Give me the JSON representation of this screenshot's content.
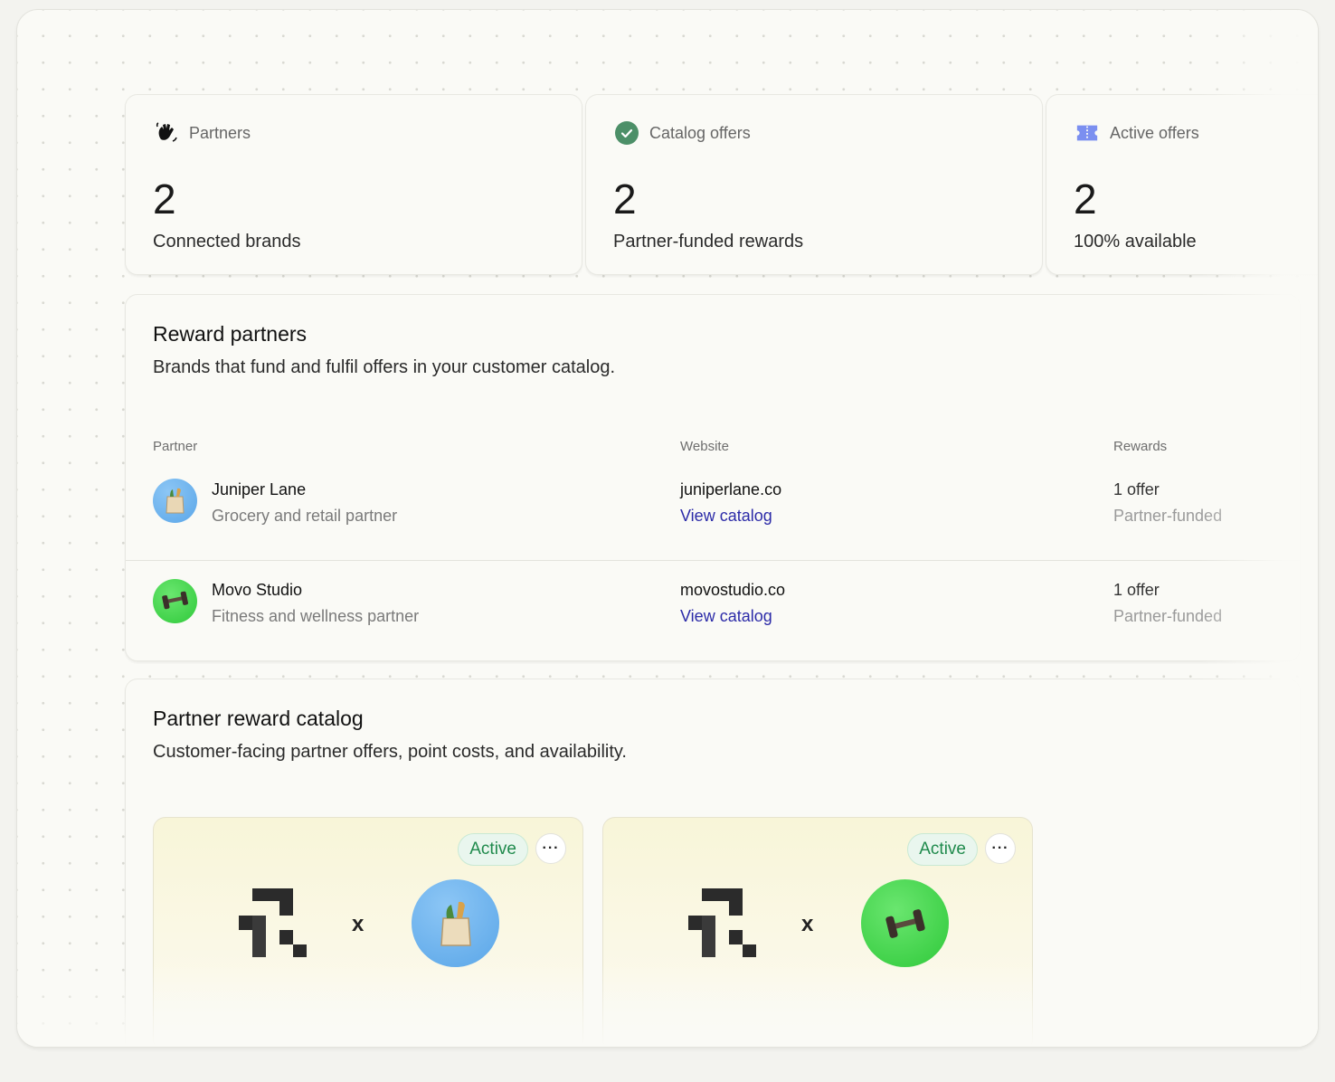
{
  "stats": [
    {
      "label": "Partners",
      "icon": "waving-hand-icon",
      "value": "2",
      "sub": "Connected brands"
    },
    {
      "label": "Catalog offers",
      "icon": "check-circle-icon",
      "value": "2",
      "sub": "Partner-funded rewards"
    },
    {
      "label": "Active offers",
      "icon": "ticket-icon",
      "value": "2",
      "sub": "100% available"
    }
  ],
  "partners_section": {
    "title": "Reward partners",
    "subtitle": "Brands that fund and fulfil offers in your customer catalog.",
    "columns": {
      "partner": "Partner",
      "website": "Website",
      "rewards": "Rewards"
    },
    "rows": [
      {
        "name": "Juniper Lane",
        "description": "Grocery and retail partner",
        "website": "juniperlane.co",
        "link": "View catalog",
        "rewards": "1 offer",
        "rewards_note": "Partner-funded",
        "avatar_icon": "grocery-bag-icon",
        "avatar_color": "#5aa6e8"
      },
      {
        "name": "Movo Studio",
        "description": "Fitness and wellness partner",
        "website": "movostudio.co",
        "link": "View catalog",
        "rewards": "1 offer",
        "rewards_note": "Partner-funded",
        "avatar_icon": "dumbbell-icon",
        "avatar_color": "#3fd64a"
      }
    ]
  },
  "catalog_section": {
    "title": "Partner reward catalog",
    "subtitle": "Customer-facing partner offers, point costs, and availability.",
    "offers": [
      {
        "status": "Active",
        "separator": "x",
        "partner_icon": "grocery-bag-icon"
      },
      {
        "status": "Active",
        "separator": "x",
        "partner_icon": "dumbbell-icon"
      }
    ]
  },
  "colors": {
    "accent_link": "#2c2ba8",
    "active_badge": "#1f8a4c",
    "check_green": "#4c8f68",
    "ticket_blue": "#7b8ff0"
  }
}
